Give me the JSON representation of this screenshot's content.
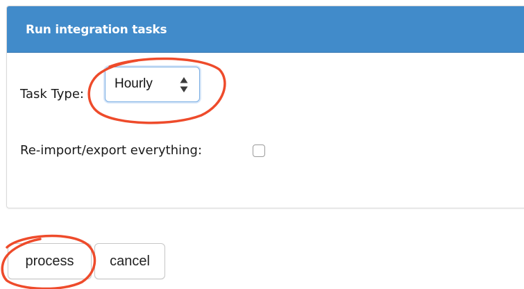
{
  "panel": {
    "title": "Run integration tasks",
    "header_color": "#418bca"
  },
  "form": {
    "task_type_label": "Task Type:",
    "task_type_value": "Hourly",
    "reimport_label": "Re-import/export everything:",
    "reimport_checked": false
  },
  "actions": {
    "process_label": "process",
    "cancel_label": "cancel"
  },
  "annotations": {
    "color": "#ee4b2b",
    "circled_items": [
      "task-type-select",
      "process-button"
    ]
  }
}
